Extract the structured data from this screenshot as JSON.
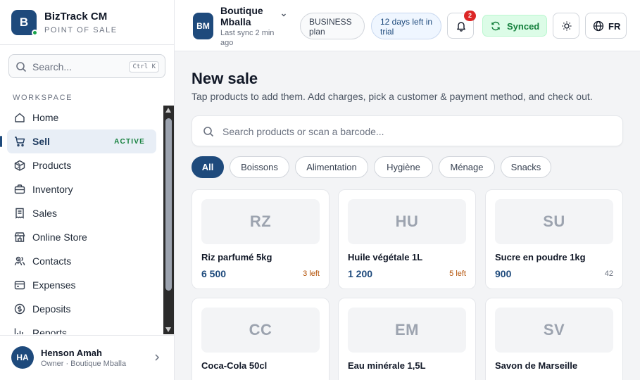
{
  "colors": {
    "brand": "#1e4a7c",
    "success": "#15803d",
    "danger": "#dc2626",
    "warning": "#b45309"
  },
  "brand": {
    "logo_letter": "B",
    "name": "BizTrack CM",
    "subtitle": "POINT OF SALE"
  },
  "search": {
    "placeholder": "Search...",
    "shortcut": "Ctrl K"
  },
  "sidebar": {
    "section_label": "WORKSPACE",
    "items": [
      {
        "label": "Home",
        "icon": "home-icon"
      },
      {
        "label": "Sell",
        "icon": "cart-icon",
        "badge": "ACTIVE"
      },
      {
        "label": "Products",
        "icon": "box-icon"
      },
      {
        "label": "Inventory",
        "icon": "briefcase-icon"
      },
      {
        "label": "Sales",
        "icon": "receipt-icon"
      },
      {
        "label": "Online Store",
        "icon": "store-icon"
      },
      {
        "label": "Contacts",
        "icon": "users-icon"
      },
      {
        "label": "Expenses",
        "icon": "wallet-icon"
      },
      {
        "label": "Deposits",
        "icon": "coin-icon"
      },
      {
        "label": "Reports",
        "icon": "chart-icon"
      }
    ]
  },
  "user": {
    "initials": "HA",
    "name": "Henson Amah",
    "role": "Owner · Boutique Mballa"
  },
  "topbar": {
    "shop_initials": "BM",
    "shop_name": "Boutique Mballa",
    "last_sync": "Last sync 2 min ago",
    "plan": "BUSINESS plan",
    "trial": "12 days left in trial",
    "notifications_count": "2",
    "sync_status": "Synced",
    "language": "FR"
  },
  "main": {
    "title": "New sale",
    "subtitle": "Tap products to add them. Add charges, pick a customer & payment method, and check out.",
    "search_placeholder": "Search products or scan a barcode...",
    "categories": [
      "All",
      "Boissons",
      "Alimentation",
      "Hygiène",
      "Ménage",
      "Snacks"
    ],
    "products": [
      {
        "initials": "RZ",
        "name": "Riz parfumé 5kg",
        "price": "6 500",
        "stock": "3 left"
      },
      {
        "initials": "HU",
        "name": "Huile végétale 1L",
        "price": "1 200",
        "stock": "5 left"
      },
      {
        "initials": "SU",
        "name": "Sucre en poudre 1kg",
        "price": "900",
        "stock": "42"
      },
      {
        "initials": "CC",
        "name": "Coca-Cola 50cl",
        "price": "",
        "stock": ""
      },
      {
        "initials": "EM",
        "name": "Eau minérale 1,5L",
        "price": "",
        "stock": ""
      },
      {
        "initials": "SV",
        "name": "Savon de Marseille",
        "price": "",
        "stock": ""
      }
    ]
  }
}
